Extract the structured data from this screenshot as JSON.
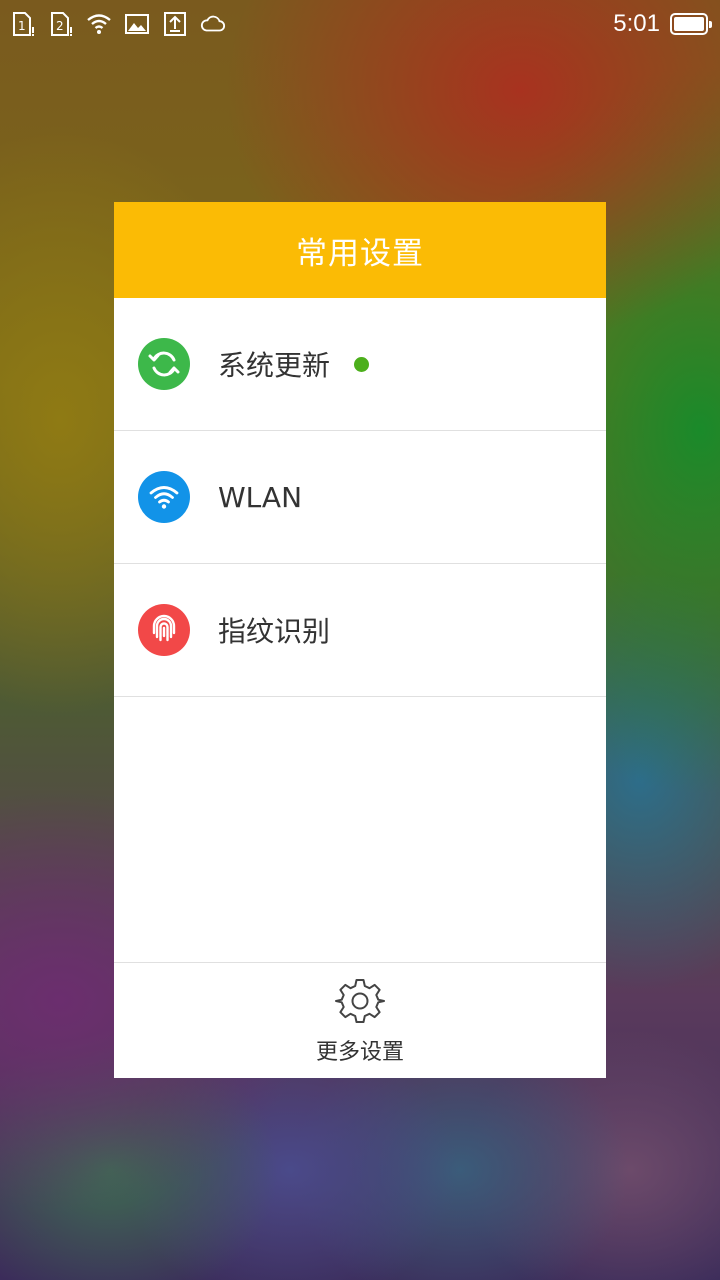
{
  "status_bar": {
    "icons": [
      "sim1-icon",
      "sim2-icon",
      "wifi-icon",
      "image-icon",
      "upload-icon",
      "cloud-icon"
    ],
    "time": "5:01",
    "battery": "battery-full-icon"
  },
  "panel": {
    "title": "常用设置",
    "header_color": "#fbbb05",
    "items": [
      {
        "label": "系统更新",
        "icon": "sync-icon",
        "icon_color": "#3db84a",
        "has_dot": true
      },
      {
        "label": "WLAN",
        "icon": "wifi-icon",
        "icon_color": "#1293e8",
        "has_dot": false
      },
      {
        "label": "指纹识别",
        "icon": "fingerprint-icon",
        "icon_color": "#f24848",
        "has_dot": false
      }
    ],
    "footer": {
      "label": "更多设置",
      "icon": "gear-icon"
    }
  }
}
